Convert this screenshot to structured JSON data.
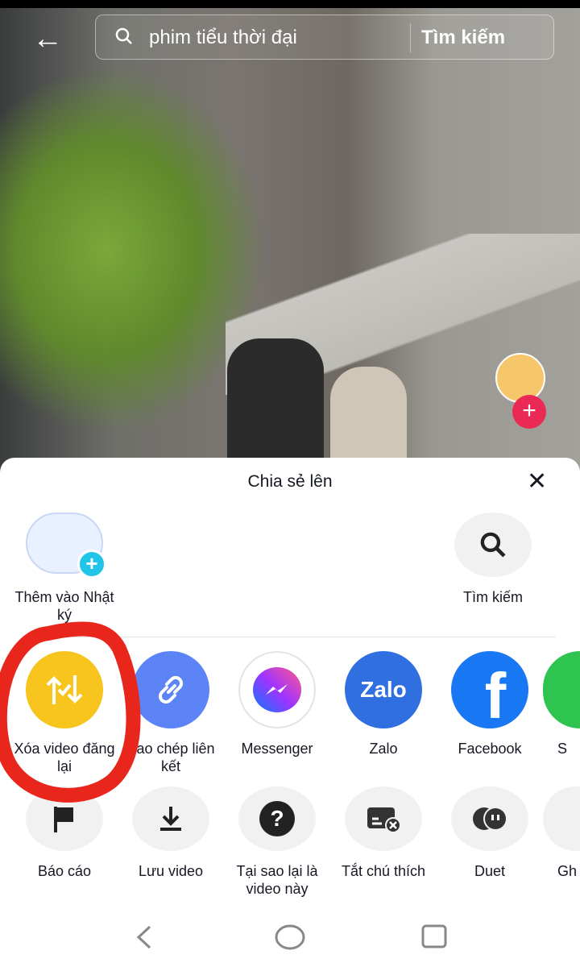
{
  "search": {
    "query": "phim tiểu thời đại",
    "button": "Tìm kiếm"
  },
  "sheet": {
    "title": "Chia sẻ lên",
    "top_row": [
      {
        "label": "Thêm vào Nhật ký",
        "icon": "add-to-diary-icon"
      },
      {
        "label": "Tìm kiếm",
        "icon": "search-icon"
      }
    ],
    "share_row": [
      {
        "label": "Xóa video đăng lại",
        "icon": "repost-icon",
        "color": "#f7c51e"
      },
      {
        "label": "Sao chép liên kết",
        "icon": "link-icon",
        "color": "#5c84f6"
      },
      {
        "label": "Messenger",
        "icon": "messenger-icon",
        "color": "#ffffff"
      },
      {
        "label": "Zalo",
        "icon": "zalo-icon",
        "color": "#2f6fe0"
      },
      {
        "label": "Facebook",
        "icon": "facebook-icon",
        "color": "#1877f2"
      },
      {
        "label": "S",
        "icon": "sms-icon",
        "color": "#2fc34f"
      }
    ],
    "action_row": [
      {
        "label": "Báo cáo",
        "icon": "flag-icon"
      },
      {
        "label": "Lưu video",
        "icon": "download-icon"
      },
      {
        "label": "Tại sao lại là video này",
        "icon": "question-icon"
      },
      {
        "label": "Tắt chú thích",
        "icon": "captions-off-icon"
      },
      {
        "label": "Duet",
        "icon": "duet-icon"
      },
      {
        "label": "Gh",
        "icon": "stitch-icon"
      }
    ],
    "zalo_text": "Zalo"
  },
  "annotation_color": "#e8261c"
}
